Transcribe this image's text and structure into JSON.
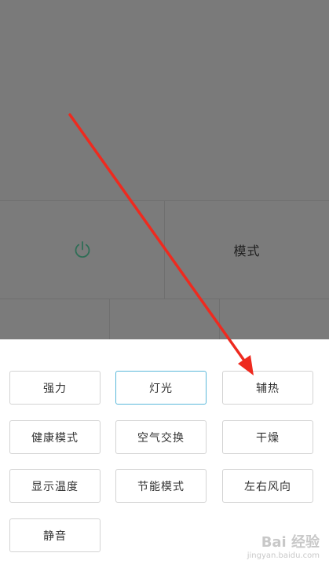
{
  "device_panel": {
    "power_icon": "power-icon",
    "mode_label": "模式",
    "icon_color": "#2f6e56"
  },
  "options_sheet": {
    "buttons": [
      {
        "label": "强力",
        "selected": false
      },
      {
        "label": "灯光",
        "selected": true
      },
      {
        "label": "辅热",
        "selected": false
      },
      {
        "label": "健康模式",
        "selected": false
      },
      {
        "label": "空气交换",
        "selected": false
      },
      {
        "label": "干燥",
        "selected": false
      },
      {
        "label": "显示温度",
        "selected": false
      },
      {
        "label": "节能模式",
        "selected": false
      },
      {
        "label": "左右风向",
        "selected": false
      },
      {
        "label": "静音",
        "selected": false
      }
    ],
    "selected_border_color": "#5bb8da"
  },
  "annotation": {
    "arrow_color": "#ee2a1f"
  },
  "watermark": {
    "brand": "Bai 经验",
    "url": "jingyan.baidu.com"
  }
}
